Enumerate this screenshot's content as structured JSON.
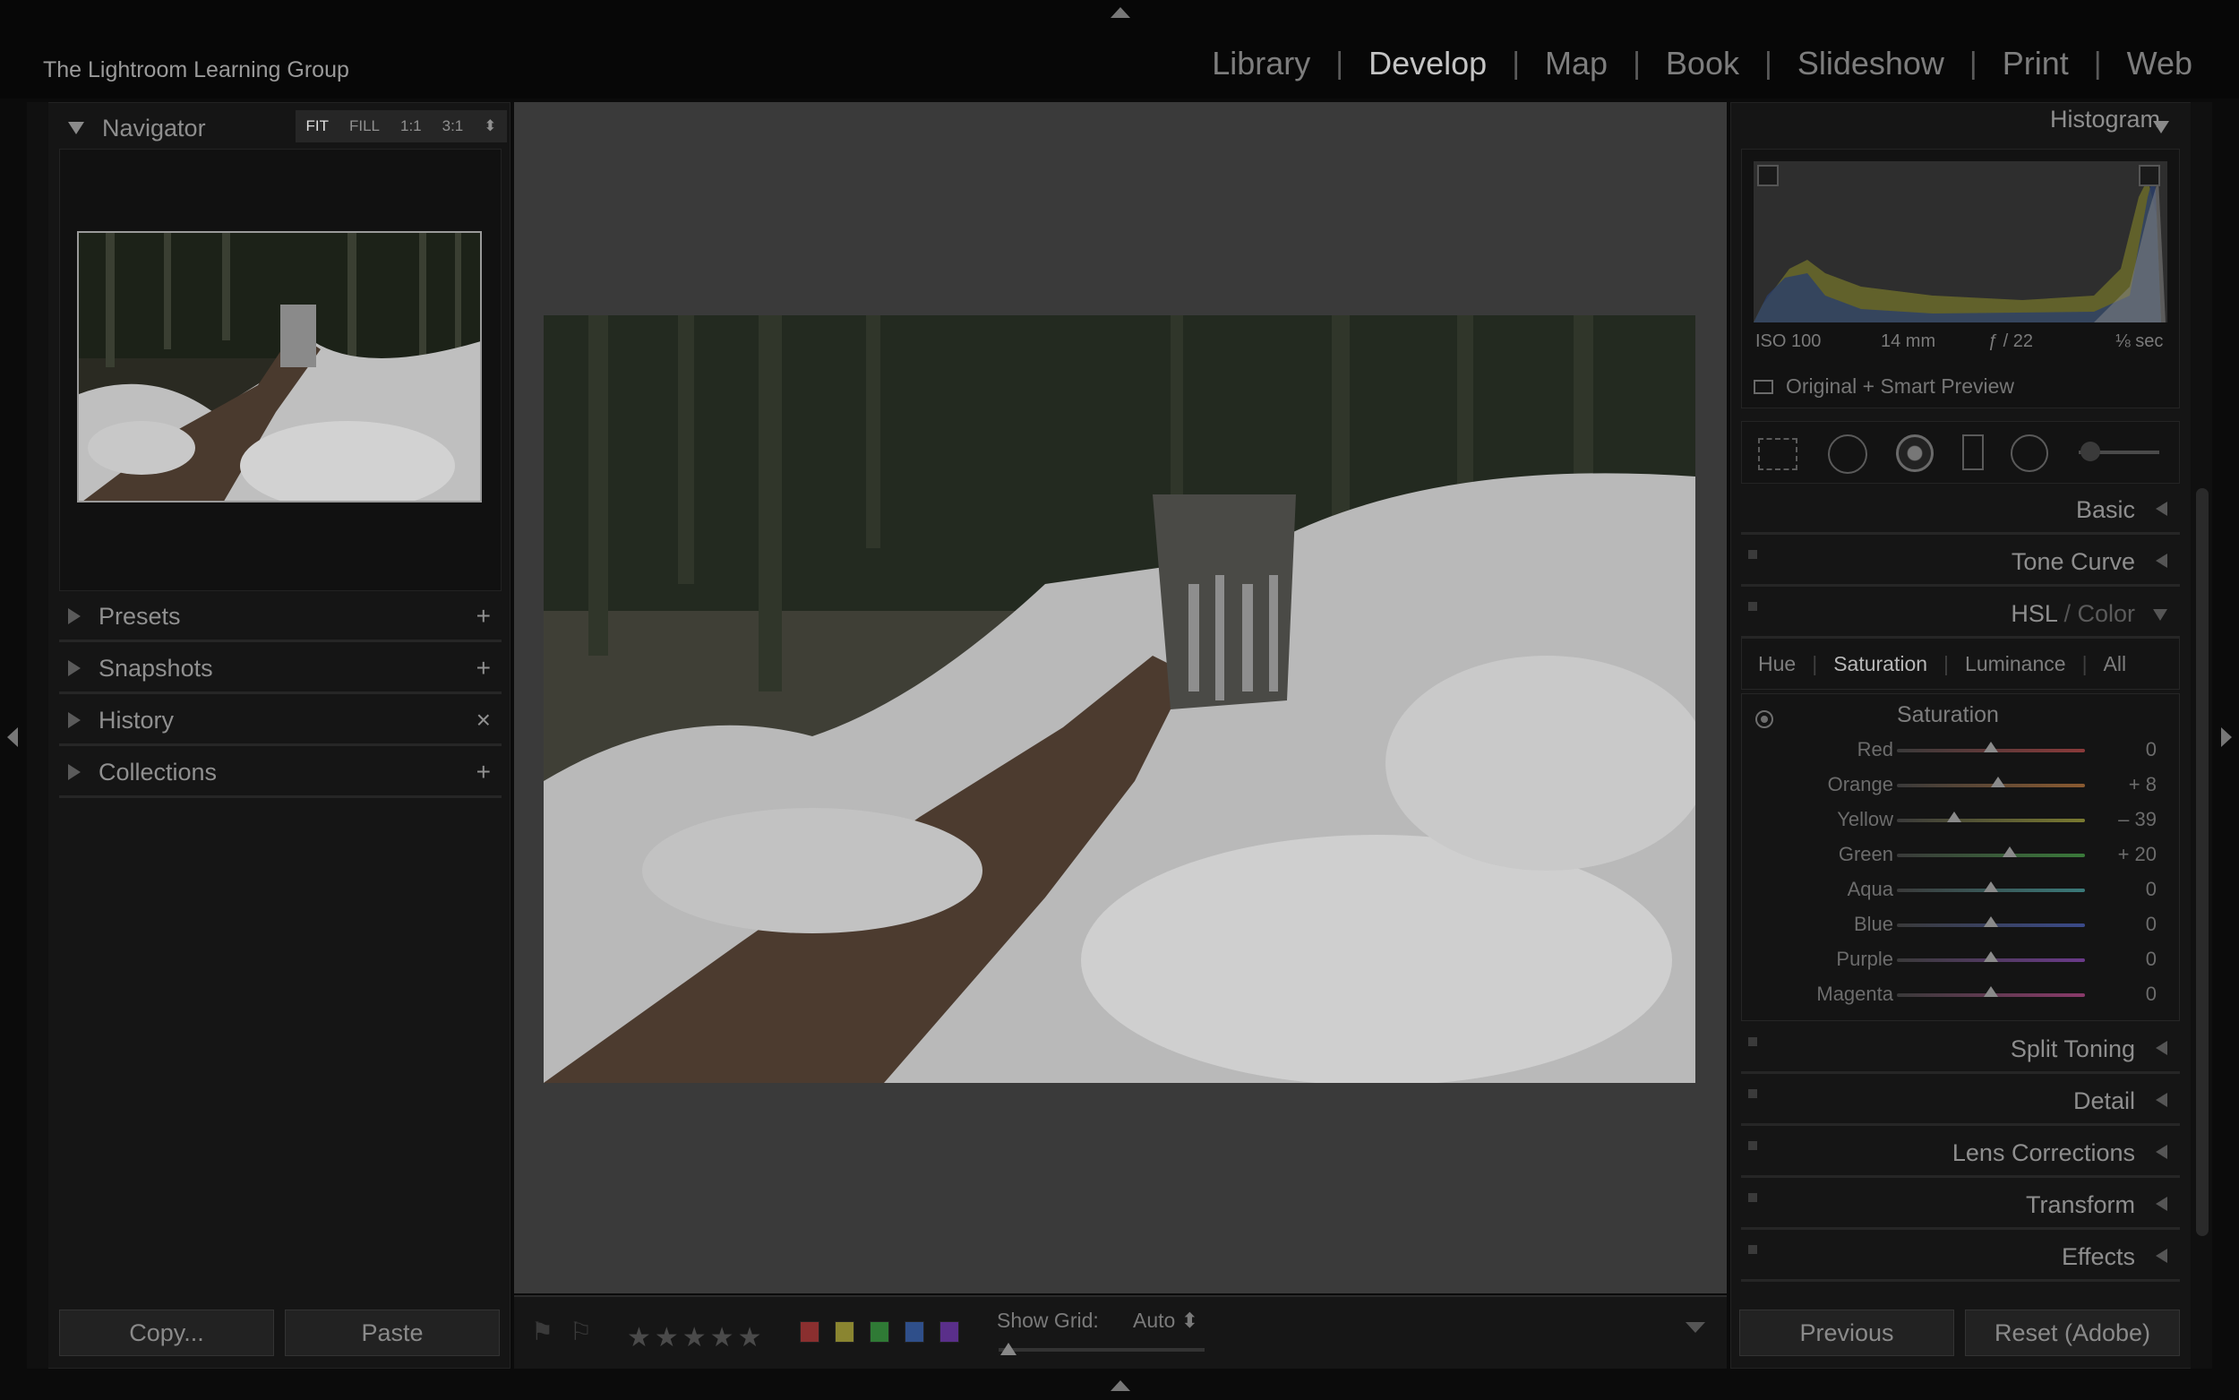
{
  "identity_plate": "The Lightroom Learning Group",
  "modules": [
    "Library",
    "Develop",
    "Map",
    "Book",
    "Slideshow",
    "Print",
    "Web"
  ],
  "active_module": "Develop",
  "navigator": {
    "title": "Navigator",
    "zoom": [
      "FIT",
      "FILL",
      "1:1",
      "3:1"
    ],
    "active_zoom": "FIT"
  },
  "left_sections": [
    {
      "label": "Presets",
      "action": "+"
    },
    {
      "label": "Snapshots",
      "action": "+"
    },
    {
      "label": "History",
      "action": "×"
    },
    {
      "label": "Collections",
      "action": "+"
    }
  ],
  "left_buttons": {
    "copy": "Copy...",
    "paste": "Paste"
  },
  "histogram": {
    "title": "Histogram",
    "iso": "ISO 100",
    "focal": "14 mm",
    "aperture": "ƒ / 22",
    "shutter": "⅛ sec",
    "preview": "Original + Smart Preview"
  },
  "right_sections": {
    "basic": "Basic",
    "tone_curve": "Tone Curve",
    "hsl_a": "HSL",
    "hsl_sep": " / ",
    "hsl_b": "Color",
    "split_toning": "Split Toning",
    "detail": "Detail",
    "lens": "Lens Corrections",
    "transform": "Transform",
    "effects": "Effects"
  },
  "hsl_tabs": [
    "Hue",
    "Saturation",
    "Luminance",
    "All"
  ],
  "hsl_active": "Saturation",
  "saturation": {
    "title": "Saturation",
    "sliders": [
      {
        "name": "Red",
        "value": "0",
        "num": 0,
        "color": "#8a3a3a"
      },
      {
        "name": "Orange",
        "value": "+ 8",
        "num": 8,
        "color": "#8a5a30"
      },
      {
        "name": "Yellow",
        "value": "– 39",
        "num": -39,
        "color": "#7a7a30"
      },
      {
        "name": "Green",
        "value": "+ 20",
        "num": 20,
        "color": "#3a7a3a"
      },
      {
        "name": "Aqua",
        "value": "0",
        "num": 0,
        "color": "#3a7a7a"
      },
      {
        "name": "Blue",
        "value": "0",
        "num": 0,
        "color": "#3a4a8a"
      },
      {
        "name": "Purple",
        "value": "0",
        "num": 0,
        "color": "#6a3a8a"
      },
      {
        "name": "Magenta",
        "value": "0",
        "num": 0,
        "color": "#8a3a6a"
      }
    ]
  },
  "right_buttons": {
    "previous": "Previous",
    "reset": "Reset (Adobe)"
  },
  "toolbar": {
    "stars": "★★★★★",
    "color_labels": [
      "#8a2f2f",
      "#8a8530",
      "#2f7a35",
      "#2f4f8a",
      "#5a2f8a"
    ],
    "grid_label": "Show Grid:",
    "grid_value": "Auto ⬍"
  }
}
